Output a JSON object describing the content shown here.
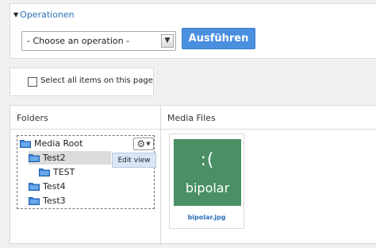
{
  "operations": {
    "title": "Operationen",
    "select_value": "- Choose an operation -",
    "run_button": "Ausführen"
  },
  "select_all": {
    "label": "Select all items on this page",
    "checked": false
  },
  "folders": {
    "header": "Folders",
    "tree": [
      {
        "label": "Media Root",
        "level": 0
      },
      {
        "label": "Test2",
        "level": 1,
        "selected": true
      },
      {
        "label": "TEST",
        "level": 2
      },
      {
        "label": "Test4",
        "level": 1
      },
      {
        "label": "Test3",
        "level": 1
      }
    ],
    "context_menu_item": "Edit view"
  },
  "media": {
    "header": "Media Files",
    "files": [
      {
        "name": "bipolar.jpg",
        "thumb_face": ":(",
        "thumb_text": "bipolar",
        "thumb_color": "#4a9064"
      }
    ]
  },
  "colors": {
    "accent": "#4a8fe0",
    "link": "#2a6fb7"
  }
}
